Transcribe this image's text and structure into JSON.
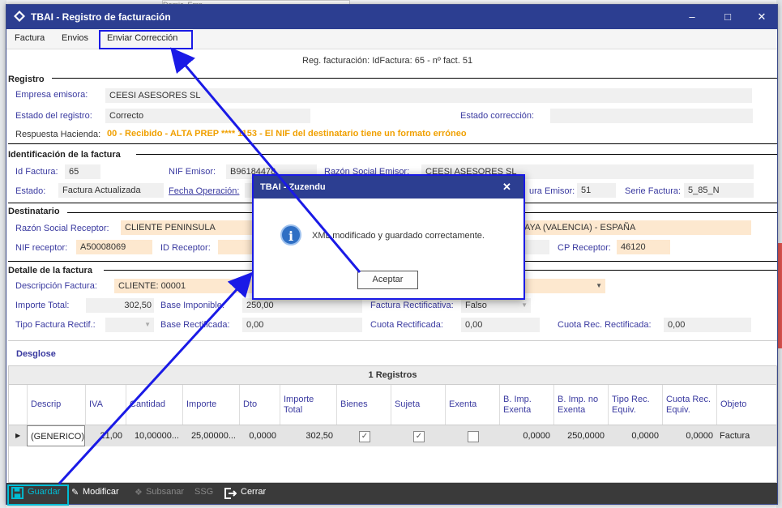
{
  "window": {
    "title": "TBAI - Registro de facturación"
  },
  "background": {
    "tab_text": "Domic. Emp."
  },
  "menu": {
    "items": [
      "Factura",
      "Envios",
      "Enviar Corrección"
    ]
  },
  "header": {
    "subtitle": "Reg. facturación: IdFactura: 65 - nº fact. 51"
  },
  "registro": {
    "section": "Registro",
    "empresa_label": "Empresa emisora:",
    "empresa_value": "CEESI ASESORES SL",
    "estado_label": "Estado del registro:",
    "estado_value": "Correcto",
    "estado_corr_label": "Estado corrección:",
    "estado_corr_value": "",
    "respuesta_label": "Respuesta Hacienda:",
    "respuesta_value": "00 - Recibido - ALTA PREP **** 1153 - El NIF del destinatario tiene un formato erróneo"
  },
  "identificacion": {
    "section": "Identificación de la factura",
    "id_label": "Id Factura:",
    "id_value": "65",
    "nif_label": "NIF Emisor:",
    "nif_value": "B96184478",
    "razon_label": "Razón Social Emisor:",
    "razon_value": "CEESI ASESORES SL",
    "estado_label": "Estado:",
    "estado_value": "Factura Actualizada",
    "fecha_label": "Fecha Operación:",
    "numfact_label": "ura Emisor:",
    "numfact_value": "51",
    "serie_label": "Serie Factura:",
    "serie_value": "5_85_N"
  },
  "destinatario": {
    "section": "Destinatario",
    "razon_label": "Razón Social Receptor:",
    "razon_value": "CLIENTE PENINSULA",
    "dir_value": "AYA (VALENCIA) - ESPAÑA",
    "nif_label": "NIF receptor:",
    "nif_value": "A50008069",
    "idrec_label": "ID Receptor:",
    "cp_label": "CP Receptor:",
    "cp_value": "46120"
  },
  "detalle": {
    "section": "Detalle de la factura",
    "desc_label": "Descripción Factura:",
    "desc_value": "CLIENTE: 00001",
    "importe_label": "Importe Total:",
    "importe_value": "302,50",
    "base_label": "Base Imponible:",
    "base_value": "250,00",
    "rectif_label": "Factura Rectificativa:",
    "rectif_value": "Falso",
    "tipo_label": "Tipo Factura Rectif.:",
    "baserect_label": "Base Rectificada:",
    "baserect_value": "0,00",
    "cuotarect_label": "Cuota Rectificada:",
    "cuotarect_value": "0,00",
    "cuotarecrect_label": "Cuota Rec. Rectificada:",
    "cuotarecrect_value": "0,00"
  },
  "desglose": {
    "section": "Desglose",
    "records": "1 Registros",
    "columns": [
      "Descrip",
      "IVA",
      "Cantidad",
      "Importe",
      "Dto",
      "Importe Total",
      "Bienes",
      "Sujeta",
      "Exenta",
      "B. Imp. Exenta",
      "B. Imp. no Exenta",
      "Tipo Rec. Equiv.",
      "Cuota Rec. Equiv.",
      "Objeto"
    ],
    "row": {
      "descrip": "(GENERICO)",
      "iva": "21,00",
      "cantidad": "10,00000...",
      "importe": "25,00000...",
      "dto": "0,0000",
      "total": "302,50",
      "bienes": true,
      "sujeta": true,
      "exenta": false,
      "bimp_exenta": "0,0000",
      "bimp_noexenta": "250,0000",
      "tipo_rec": "0,0000",
      "cuota_rec": "0,0000",
      "objeto": "Factura"
    }
  },
  "bottom": {
    "guardar": "Guardar",
    "modificar": "Modificar",
    "subsanar": "Subsanar",
    "ssg": "SSG",
    "cerrar": "Cerrar"
  },
  "dialog": {
    "title": "TBAI - Zuzendu",
    "message": "XML modificado y guardado correctamente.",
    "button": "Aceptar"
  },
  "colors": {
    "title_bar": "#2c3e91",
    "highlight": "#1a1ae6",
    "field_orange": "#fde8cf",
    "warning": "#f0a000",
    "guardar": "#00bcd4"
  }
}
